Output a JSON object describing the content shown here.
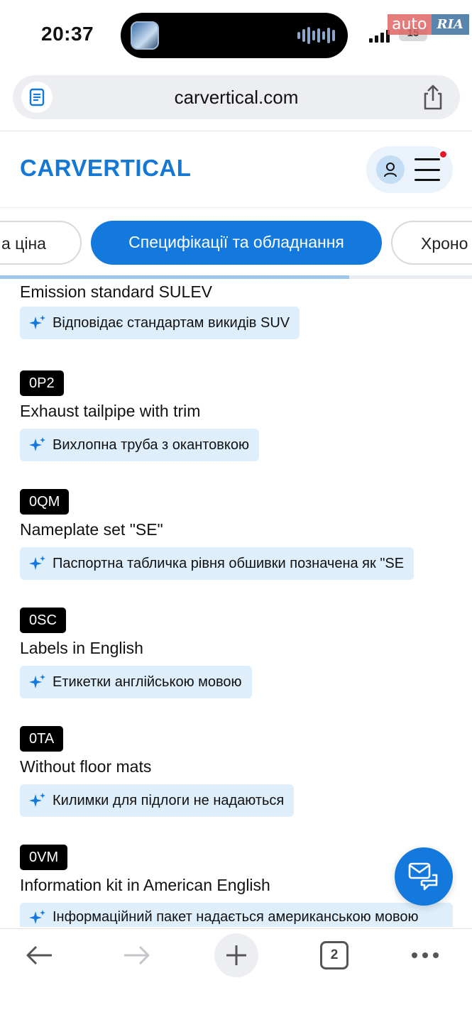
{
  "status_bar": {
    "time": "20:37",
    "battery": "15",
    "watermark_auto": "auto",
    "watermark_ria": "RIA"
  },
  "browser": {
    "url": "carvertical.com"
  },
  "site": {
    "logo": "CARVERTICAL",
    "brand_color": "#1478d4"
  },
  "tabs": [
    {
      "label": "а ціна"
    },
    {
      "label": "Специфікації та обладнання",
      "active": true
    },
    {
      "label": "Хроно"
    }
  ],
  "tab_scroll_progress": 0.74,
  "items": [
    {
      "code": "",
      "name": "Emission standard SULEV",
      "translation": "Відповідає стандартам викидів SUV"
    },
    {
      "code": "0P2",
      "name": "Exhaust tailpipe with trim",
      "translation": "Вихлопна труба з окантовкою"
    },
    {
      "code": "0QM",
      "name": "Nameplate set \"SE\"",
      "translation": "Паспортна табличка рівня обшивки позначена як \"SE"
    },
    {
      "code": "0SC",
      "name": "Labels in English",
      "translation": "Етикетки англійською мовою"
    },
    {
      "code": "0TA",
      "name": "Without floor mats",
      "translation": "Килимки для підлоги не надаються"
    },
    {
      "code": "0VM",
      "name": "Information kit in American English",
      "translation": "Інформаційний пакет надається американською мовою"
    }
  ],
  "toolbar": {
    "tab_count": "2"
  },
  "colors": {
    "accent": "#1479dd",
    "translation_bg": "#deeefb",
    "code_badge": "#000000"
  }
}
